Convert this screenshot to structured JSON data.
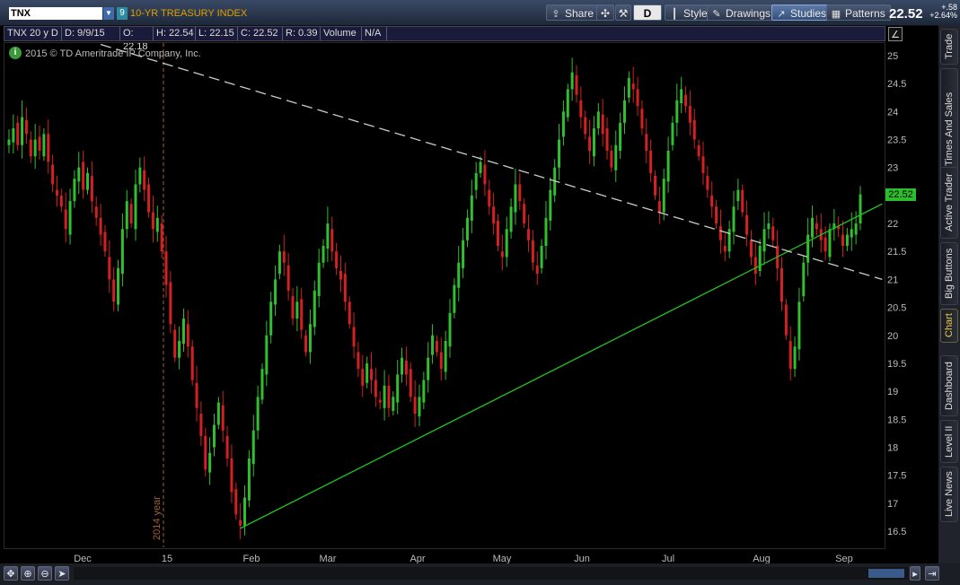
{
  "toolbar": {
    "symbol": "TNX",
    "symbol_count": "9",
    "symbol_name": "10-YR TREASURY INDEX",
    "buttons": {
      "share": "Share",
      "period": "D",
      "style": "Style",
      "drawings": "Drawings",
      "studies": "Studies",
      "patterns": "Patterns"
    },
    "last_price": "22.52",
    "change": "+.58",
    "change_pct": "+2.64%"
  },
  "info": {
    "symbol_period": "TNX 20 y D",
    "date": "D: 9/9/15",
    "open": "O: 22.18",
    "high": "H: 22.54",
    "low": "L: 22.15",
    "close": "C: 22.52",
    "range": "R: 0.39",
    "volume_label": "Volume",
    "volume_value": "N/A"
  },
  "copyright": "2015 © TD Ameritrade IP Company, Inc.",
  "sidebar": {
    "tabs": [
      "Trade",
      "Times And Sales",
      "Active Trader",
      "Big Buttons",
      "Chart",
      "Dashboard",
      "Level II",
      "Live News"
    ]
  },
  "colors": {
    "up": "#2fbf2f",
    "down": "#d42020",
    "trendline_green": "#22c022",
    "trendline_dashed": "#cccccc",
    "background": "#000000"
  },
  "chart_data": {
    "type": "candlestick",
    "symbol": "TNX",
    "period": "D",
    "ylim": [
      16.3,
      25.2
    ],
    "y_ticks": [
      "25",
      "24.5",
      "24",
      "23.5",
      "23",
      "22.5",
      "22",
      "21.5",
      "21",
      "20.5",
      "20",
      "19.5",
      "19",
      "18.5",
      "18",
      "17.5",
      "17",
      "16.5"
    ],
    "x_ticks": [
      "Dec",
      "15",
      "Feb",
      "Mar",
      "Apr",
      "May",
      "Jun",
      "Jul",
      "Aug",
      "Sep"
    ],
    "year_marker": "2014 year",
    "last_price_label": "22.52",
    "closes": [
      23.5,
      23.7,
      23.4,
      23.9,
      23.6,
      23.2,
      23.5,
      23.3,
      23.6,
      23.1,
      22.7,
      22.5,
      22.3,
      21.9,
      22.4,
      22.8,
      23.0,
      22.6,
      22.9,
      22.4,
      22.1,
      21.8,
      21.5,
      21.0,
      20.6,
      21.2,
      21.9,
      22.4,
      22.0,
      22.7,
      23.0,
      22.6,
      22.2,
      21.9,
      22.1,
      21.5,
      20.9,
      20.2,
      19.6,
      19.9,
      20.3,
      19.8,
      19.2,
      18.7,
      18.2,
      17.6,
      17.9,
      18.4,
      18.8,
      18.3,
      17.8,
      17.2,
      16.8,
      16.6,
      17.1,
      17.8,
      18.3,
      18.9,
      19.4,
      20.0,
      20.6,
      21.0,
      21.5,
      21.3,
      20.8,
      20.3,
      20.6,
      20.1,
      19.7,
      20.2,
      20.8,
      21.3,
      21.6,
      22.0,
      21.5,
      21.2,
      21.0,
      20.6,
      20.2,
      19.8,
      19.4,
      19.1,
      19.5,
      19.2,
      18.9,
      18.8,
      19.1,
      18.7,
      18.9,
      19.3,
      19.6,
      19.3,
      18.9,
      18.6,
      18.9,
      19.2,
      19.6,
      20.0,
      19.7,
      19.4,
      19.9,
      20.4,
      20.9,
      21.3,
      21.7,
      22.1,
      22.5,
      22.9,
      23.1,
      22.7,
      22.3,
      22.0,
      21.6,
      21.4,
      21.9,
      22.3,
      22.7,
      22.4,
      22.0,
      21.7,
      21.3,
      21.1,
      21.6,
      22.1,
      22.6,
      23.0,
      23.5,
      24.0,
      24.4,
      24.7,
      24.3,
      23.9,
      23.6,
      23.3,
      23.7,
      24.0,
      23.6,
      23.3,
      23.0,
      23.4,
      23.8,
      24.2,
      24.6,
      24.4,
      24.1,
      23.7,
      23.3,
      22.9,
      22.5,
      22.2,
      22.8,
      23.3,
      23.8,
      24.2,
      24.4,
      24.1,
      23.8,
      23.5,
      23.2,
      22.9,
      22.6,
      22.3,
      22.0,
      21.7,
      21.5,
      21.9,
      22.3,
      22.6,
      22.2,
      21.8,
      21.4,
      21.1,
      21.6,
      21.9,
      22.0,
      21.7,
      21.2,
      20.6,
      20.0,
      19.4,
      19.8,
      20.6,
      21.3,
      21.8,
      22.1,
      21.9,
      21.7,
      21.5,
      21.9,
      22.0,
      21.9,
      21.6,
      21.8,
      21.9,
      22.0,
      22.52
    ],
    "trendlines": [
      {
        "style": "solid",
        "color": "green",
        "start": {
          "index": 53,
          "value": 16.55
        },
        "end": {
          "index": 200,
          "value": 22.35
        }
      },
      {
        "style": "dashed",
        "color": "white",
        "start": {
          "index": 21,
          "value": 25.2
        },
        "end": {
          "index": 200,
          "value": 21.0
        }
      }
    ]
  }
}
